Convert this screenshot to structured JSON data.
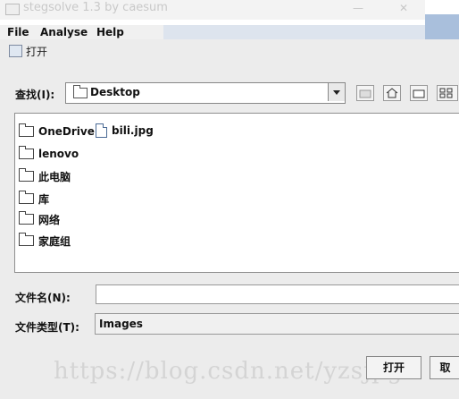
{
  "app": {
    "title": "stegsolve 1.3 by caesum",
    "menus": [
      "File",
      "Analyse",
      "Help"
    ]
  },
  "dialog": {
    "title": "打开",
    "look_in_label": "查找(I):",
    "look_in_value": "Desktop",
    "items": [
      {
        "name": "OneDrive",
        "icon": "folder-icon"
      },
      {
        "name": "bili.jpg",
        "icon": "file-icon"
      },
      {
        "name": "lenovo",
        "icon": "folder-icon"
      },
      {
        "name": "此电脑",
        "icon": "folder-icon"
      },
      {
        "name": "库",
        "icon": "folder-icon"
      },
      {
        "name": "网络",
        "icon": "folder-icon"
      },
      {
        "name": "家庭组",
        "icon": "folder-icon"
      }
    ],
    "file_name_label": "文件名(N):",
    "file_name_value": "",
    "file_type_label": "文件类型(T):",
    "file_type_value": "Images",
    "open_button": "打开",
    "cancel_button": "取"
  },
  "watermark": "https://blog.csdn.net/yzsjpg"
}
